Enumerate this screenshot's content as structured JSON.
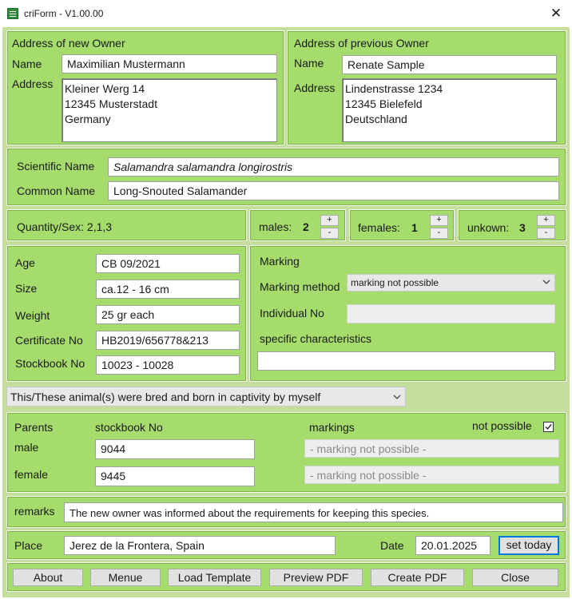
{
  "window": {
    "title": "criForm - V1.00.00",
    "icon": "form-icon",
    "close_glyph": "✕"
  },
  "new_owner": {
    "heading": "Address of new Owner",
    "name_label": "Name",
    "name_value": "Maximilian Mustermann",
    "address_label": "Address",
    "address_value": "Kleiner Werg 14\n12345 Musterstadt\nGermany"
  },
  "prev_owner": {
    "heading": "Address of previous Owner",
    "name_label": "Name",
    "name_value": "Renate Sample",
    "address_label": "Address",
    "address_value": "Lindenstrasse 1234\n12345 Bielefeld\nDeutschland"
  },
  "species": {
    "scientific_label": "Scientific Name",
    "scientific_value": "Salamandra salamandra longirostris",
    "common_label": "Common Name",
    "common_value": "Long-Snouted Salamander"
  },
  "quantity": {
    "label": "Quantity/Sex: 2,1,3",
    "males_label": "males:",
    "males_value": "2",
    "females_label": "females:",
    "females_value": "1",
    "unknown_label": "unkown:",
    "unknown_value": "3",
    "plus": "+",
    "minus": "-"
  },
  "animal": {
    "age_label": "Age",
    "age_value": "CB 09/2021",
    "size_label": "Size",
    "size_value": "ca.12 - 16 cm",
    "weight_label": "Weight",
    "weight_value": "25 gr each",
    "certificate_label": "Certificate No",
    "certificate_value": "HB2019/656778&213",
    "stockbook_label": "Stockbook No",
    "stockbook_value": "10023 - 10028"
  },
  "marking": {
    "heading": "Marking",
    "method_label": "Marking method",
    "method_value": "marking not possible",
    "individual_label": "Individual No",
    "individual_value": "",
    "specific_label": "specific characteristics",
    "specific_value": ""
  },
  "origin": {
    "value": "This/These animal(s) were bred and born in captivity by myself"
  },
  "parents": {
    "heading": "Parents",
    "stockbook_heading": "stockbook No",
    "markings_heading": "markings",
    "not_possible_label": "not possible",
    "not_possible_checked": true,
    "male_label": "male",
    "male_stockbook": "9044",
    "male_marking": "- marking not possible -",
    "female_label": "female",
    "female_stockbook": "9445",
    "female_marking": "- marking not possible -"
  },
  "remarks": {
    "label": "remarks",
    "value": "The new owner was informed about the requirements for keeping this species."
  },
  "place": {
    "label": "Place",
    "value": "Jerez de la Frontera, Spain",
    "date_label": "Date",
    "date_value": "20.01.2025",
    "set_today": "set today"
  },
  "buttons": {
    "about": "About",
    "menue": "Menue",
    "load_template": "Load Template",
    "preview_pdf": "Preview PDF",
    "create_pdf": "Create PDF",
    "close": "Close"
  },
  "colors": {
    "client": "#c4df9b",
    "panel": "#a6dc6c",
    "focus": "#0078d7"
  }
}
